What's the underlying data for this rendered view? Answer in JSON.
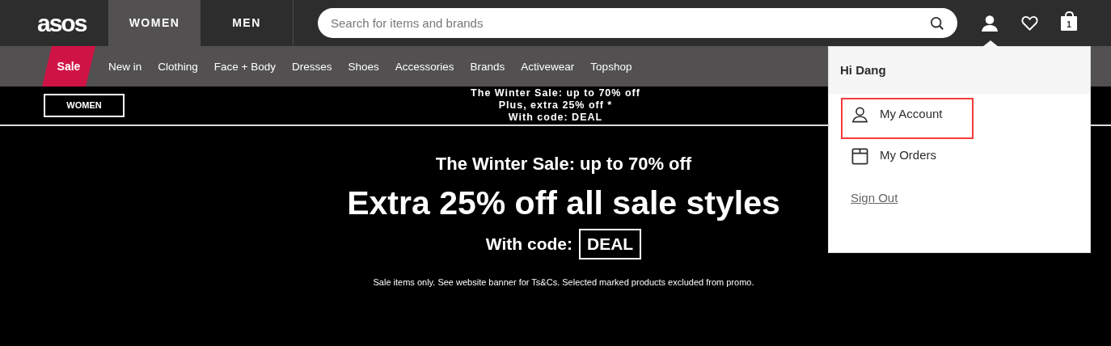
{
  "header": {
    "logo": "asos",
    "gender_tabs": [
      {
        "label": "WOMEN",
        "selected": true
      },
      {
        "label": "MEN",
        "selected": false
      }
    ],
    "search": {
      "placeholder": "Search for items and brands"
    },
    "cart_count": "1"
  },
  "nav": {
    "items": [
      {
        "label": "Sale",
        "kind": "sale"
      },
      {
        "label": "New in",
        "kind": "link"
      },
      {
        "label": "Clothing",
        "kind": "link"
      },
      {
        "label": "Face + Body",
        "kind": "link"
      },
      {
        "label": "Dresses",
        "kind": "link"
      },
      {
        "label": "Shoes",
        "kind": "link"
      },
      {
        "label": "Accessories",
        "kind": "link"
      },
      {
        "label": "Brands",
        "kind": "link"
      },
      {
        "label": "Activewear",
        "kind": "link"
      },
      {
        "label": "Topshop",
        "kind": "link"
      }
    ]
  },
  "promo_strip": {
    "button": "WOMEN",
    "lines": [
      "The Winter Sale: up to 70% off",
      "Plus, extra 25% off *",
      "With code: DEAL"
    ]
  },
  "hero": {
    "eyebrow": "The Winter Sale: up to 70% off",
    "headline": "Extra 25% off all sale styles",
    "code_label": "With code:",
    "code": "DEAL",
    "terms": "Sale items only. See website banner for Ts&Cs. Selected marked products excluded from promo."
  },
  "account_menu": {
    "greeting": "Hi Dang",
    "items": [
      {
        "label": "My Account",
        "kind": "account",
        "selected": true
      },
      {
        "label": "My Orders",
        "kind": "orders",
        "selected": false
      }
    ],
    "sign_out": "Sign Out"
  }
}
